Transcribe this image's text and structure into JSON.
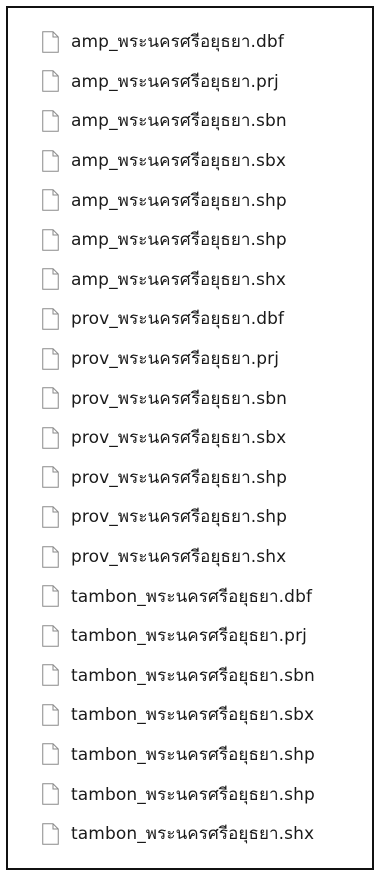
{
  "file_list": {
    "icon": "blank-file-icon",
    "files": [
      {
        "name": "amp_พระนครศรีอยุธยา.dbf"
      },
      {
        "name": "amp_พระนครศรีอยุธยา.prj"
      },
      {
        "name": "amp_พระนครศรีอยุธยา.sbn"
      },
      {
        "name": "amp_พระนครศรีอยุธยา.sbx"
      },
      {
        "name": "amp_พระนครศรีอยุธยา.shp"
      },
      {
        "name": "amp_พระนครศรีอยุธยา.shp"
      },
      {
        "name": "amp_พระนครศรีอยุธยา.shx"
      },
      {
        "name": "prov_พระนครศรีอยุธยา.dbf"
      },
      {
        "name": "prov_พระนครศรีอยุธยา.prj"
      },
      {
        "name": "prov_พระนครศรีอยุธยา.sbn"
      },
      {
        "name": "prov_พระนครศรีอยุธยา.sbx"
      },
      {
        "name": "prov_พระนครศรีอยุธยา.shp"
      },
      {
        "name": "prov_พระนครศรีอยุธยา.shp"
      },
      {
        "name": "prov_พระนครศรีอยุธยา.shx"
      },
      {
        "name": "tambon_พระนครศรีอยุธยา.dbf"
      },
      {
        "name": "tambon_พระนครศรีอยุธยา.prj"
      },
      {
        "name": "tambon_พระนครศรีอยุธยา.sbn"
      },
      {
        "name": "tambon_พระนครศรีอยุธยา.sbx"
      },
      {
        "name": "tambon_พระนครศรีอยุธยา.shp"
      },
      {
        "name": "tambon_พระนครศรีอยุธยา.shp"
      },
      {
        "name": "tambon_พระนครศรีอยุธยา.shx"
      }
    ]
  }
}
